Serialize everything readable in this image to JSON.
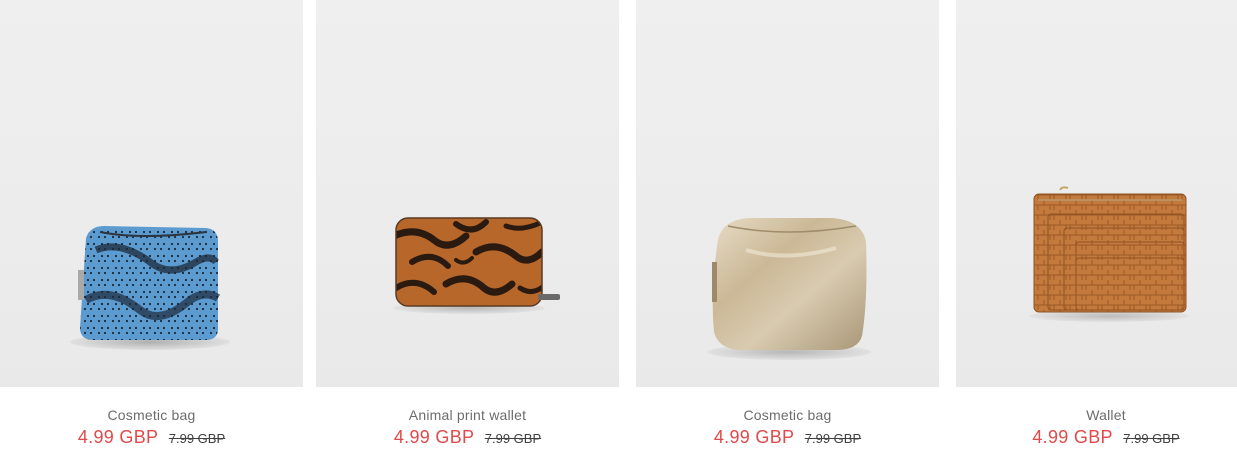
{
  "products": [
    {
      "title": "Cosmetic bag",
      "price": "4.99 GBP",
      "old_price": "7.99 GBP",
      "image_icon": "snake-print-cosmetic-bag-image",
      "image_color": "#4a86b8"
    },
    {
      "title": "Animal print wallet",
      "price": "4.99 GBP",
      "old_price": "7.99 GBP",
      "image_icon": "zebra-print-wallet-image",
      "image_color": "#b8672a"
    },
    {
      "title": "Cosmetic bag",
      "price": "4.99 GBP",
      "old_price": "7.99 GBP",
      "image_icon": "metallic-cosmetic-bag-image",
      "image_color": "#c9b89a"
    },
    {
      "title": "Wallet",
      "price": "4.99 GBP",
      "old_price": "7.99 GBP",
      "image_icon": "croc-card-wallet-image",
      "image_color": "#c47a3c"
    }
  ],
  "colors": {
    "sale_price": "#e24a4a",
    "old_price": "#404040",
    "title": "#6c6c6c",
    "image_bg": "#ececec"
  }
}
